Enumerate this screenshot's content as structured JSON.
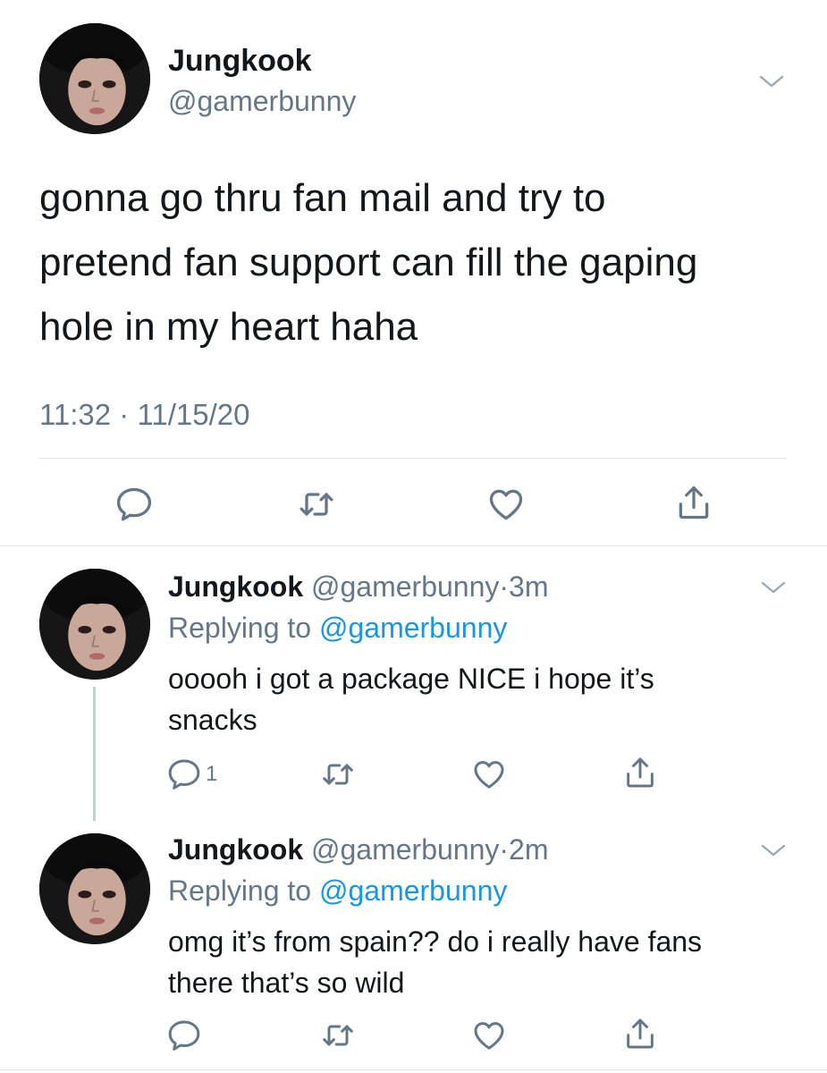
{
  "main_tweet": {
    "name": "Jungkook",
    "handle": "@gamerbunny",
    "text": "gonna go thru fan mail and try to\npretend fan support can fill the gaping\nhole in my heart haha",
    "timestamp": "11:32 · 11/15/20",
    "actions": [
      "reply-icon",
      "retweet-icon",
      "like-icon",
      "share-icon"
    ]
  },
  "replies": [
    {
      "name": "Jungkook",
      "handle": "@gamerbunny",
      "dot": "·",
      "time": "3m",
      "replying_prefix": "Replying to ",
      "replying_handle": "@gamerbunny",
      "text": "ooooh i got a package NICE i hope it’s\nsnacks",
      "reply_count": "1"
    },
    {
      "name": "Jungkook",
      "handle": "@gamerbunny",
      "dot": "·",
      "time": "2m",
      "replying_prefix": "Replying to ",
      "replying_handle": "@gamerbunny",
      "text": "omg it’s from spain?? do i really have fans\nthere that’s so wild",
      "reply_count": ""
    }
  ],
  "colors": {
    "text_primary": "#14171a",
    "text_secondary": "#657786",
    "link": "#1b95e0",
    "divider": "#e1e8ed",
    "thread_line": "#c4cfd6"
  }
}
